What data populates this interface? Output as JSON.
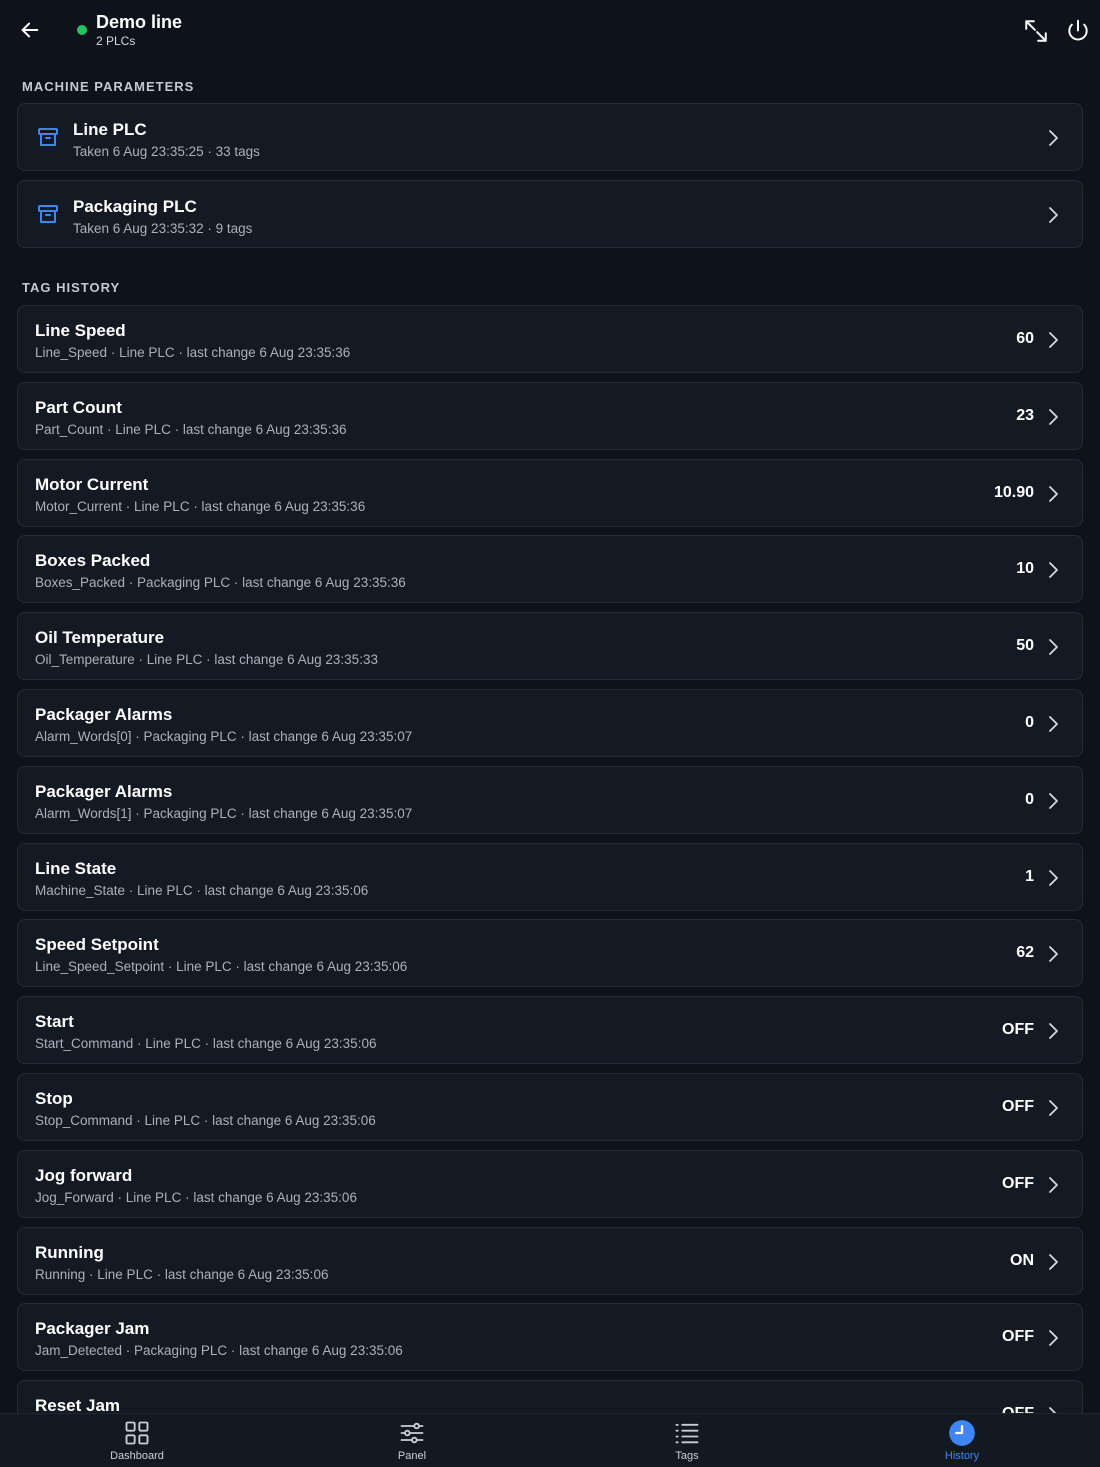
{
  "header": {
    "title": "Demo line",
    "subtitle": "2 PLCs",
    "status_color": "#22c55e",
    "back_icon": "arrow-left-icon",
    "expand_icon": "collapse-arrows-icon",
    "power_icon": "power-icon"
  },
  "sections": {
    "machine_parameters": "MACHINE PARAMETERS",
    "tag_history": "TAG HISTORY"
  },
  "plcs": [
    {
      "name": "Line PLC",
      "detail": "Taken 6 Aug 23:35:25 · 33 tags"
    },
    {
      "name": "Packaging PLC",
      "detail": "Taken 6 Aug 23:35:32 · 9 tags"
    }
  ],
  "tags": [
    {
      "name": "Line Speed",
      "detail": "Line_Speed · Line PLC · last change 6 Aug 23:35:36",
      "value": "60"
    },
    {
      "name": "Part Count",
      "detail": "Part_Count · Line PLC · last change 6 Aug 23:35:36",
      "value": "23"
    },
    {
      "name": "Motor Current",
      "detail": "Motor_Current · Line PLC · last change 6 Aug 23:35:36",
      "value": "10.90"
    },
    {
      "name": "Boxes Packed",
      "detail": "Boxes_Packed · Packaging PLC · last change 6 Aug 23:35:36",
      "value": "10"
    },
    {
      "name": "Oil Temperature",
      "detail": "Oil_Temperature · Line PLC · last change 6 Aug 23:35:33",
      "value": "50"
    },
    {
      "name": "Packager Alarms",
      "detail": "Alarm_Words[0] · Packaging PLC · last change 6 Aug 23:35:07",
      "value": "0"
    },
    {
      "name": "Packager Alarms",
      "detail": "Alarm_Words[1] · Packaging PLC · last change 6 Aug 23:35:07",
      "value": "0"
    },
    {
      "name": "Line State",
      "detail": "Machine_State · Line PLC · last change 6 Aug 23:35:06",
      "value": "1"
    },
    {
      "name": "Speed Setpoint",
      "detail": "Line_Speed_Setpoint · Line PLC · last change 6 Aug 23:35:06",
      "value": "62"
    },
    {
      "name": "Start",
      "detail": "Start_Command · Line PLC · last change 6 Aug 23:35:06",
      "value": "OFF"
    },
    {
      "name": "Stop",
      "detail": "Stop_Command · Line PLC · last change 6 Aug 23:35:06",
      "value": "OFF"
    },
    {
      "name": "Jog forward",
      "detail": "Jog_Forward · Line PLC · last change 6 Aug 23:35:06",
      "value": "OFF"
    },
    {
      "name": "Running",
      "detail": "Running · Line PLC · last change 6 Aug 23:35:06",
      "value": "ON"
    },
    {
      "name": "Packager Jam",
      "detail": "Jam_Detected · Packaging PLC · last change 6 Aug 23:35:06",
      "value": "OFF"
    },
    {
      "name": "Reset Jam",
      "detail": "",
      "value": "OFF"
    }
  ],
  "nav": {
    "items": [
      {
        "label": "Dashboard",
        "icon": "dashboard-grid-icon"
      },
      {
        "label": "Panel",
        "icon": "sliders-icon"
      },
      {
        "label": "Tags",
        "icon": "list-icon"
      },
      {
        "label": "History",
        "icon": "clock-icon"
      }
    ],
    "active": "History",
    "accent": "#3f86f5"
  }
}
